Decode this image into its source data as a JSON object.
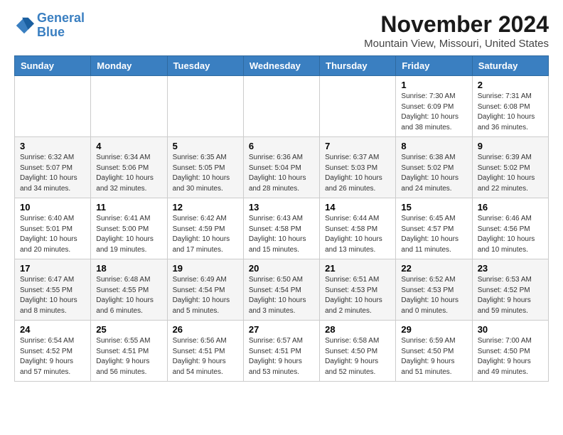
{
  "logo": {
    "line1": "General",
    "line2": "Blue"
  },
  "header": {
    "title": "November 2024",
    "location": "Mountain View, Missouri, United States"
  },
  "days_of_week": [
    "Sunday",
    "Monday",
    "Tuesday",
    "Wednesday",
    "Thursday",
    "Friday",
    "Saturday"
  ],
  "weeks": [
    [
      {
        "day": "",
        "info": ""
      },
      {
        "day": "",
        "info": ""
      },
      {
        "day": "",
        "info": ""
      },
      {
        "day": "",
        "info": ""
      },
      {
        "day": "",
        "info": ""
      },
      {
        "day": "1",
        "info": "Sunrise: 7:30 AM\nSunset: 6:09 PM\nDaylight: 10 hours and 38 minutes."
      },
      {
        "day": "2",
        "info": "Sunrise: 7:31 AM\nSunset: 6:08 PM\nDaylight: 10 hours and 36 minutes."
      }
    ],
    [
      {
        "day": "3",
        "info": "Sunrise: 6:32 AM\nSunset: 5:07 PM\nDaylight: 10 hours and 34 minutes."
      },
      {
        "day": "4",
        "info": "Sunrise: 6:34 AM\nSunset: 5:06 PM\nDaylight: 10 hours and 32 minutes."
      },
      {
        "day": "5",
        "info": "Sunrise: 6:35 AM\nSunset: 5:05 PM\nDaylight: 10 hours and 30 minutes."
      },
      {
        "day": "6",
        "info": "Sunrise: 6:36 AM\nSunset: 5:04 PM\nDaylight: 10 hours and 28 minutes."
      },
      {
        "day": "7",
        "info": "Sunrise: 6:37 AM\nSunset: 5:03 PM\nDaylight: 10 hours and 26 minutes."
      },
      {
        "day": "8",
        "info": "Sunrise: 6:38 AM\nSunset: 5:02 PM\nDaylight: 10 hours and 24 minutes."
      },
      {
        "day": "9",
        "info": "Sunrise: 6:39 AM\nSunset: 5:02 PM\nDaylight: 10 hours and 22 minutes."
      }
    ],
    [
      {
        "day": "10",
        "info": "Sunrise: 6:40 AM\nSunset: 5:01 PM\nDaylight: 10 hours and 20 minutes."
      },
      {
        "day": "11",
        "info": "Sunrise: 6:41 AM\nSunset: 5:00 PM\nDaylight: 10 hours and 19 minutes."
      },
      {
        "day": "12",
        "info": "Sunrise: 6:42 AM\nSunset: 4:59 PM\nDaylight: 10 hours and 17 minutes."
      },
      {
        "day": "13",
        "info": "Sunrise: 6:43 AM\nSunset: 4:58 PM\nDaylight: 10 hours and 15 minutes."
      },
      {
        "day": "14",
        "info": "Sunrise: 6:44 AM\nSunset: 4:58 PM\nDaylight: 10 hours and 13 minutes."
      },
      {
        "day": "15",
        "info": "Sunrise: 6:45 AM\nSunset: 4:57 PM\nDaylight: 10 hours and 11 minutes."
      },
      {
        "day": "16",
        "info": "Sunrise: 6:46 AM\nSunset: 4:56 PM\nDaylight: 10 hours and 10 minutes."
      }
    ],
    [
      {
        "day": "17",
        "info": "Sunrise: 6:47 AM\nSunset: 4:55 PM\nDaylight: 10 hours and 8 minutes."
      },
      {
        "day": "18",
        "info": "Sunrise: 6:48 AM\nSunset: 4:55 PM\nDaylight: 10 hours and 6 minutes."
      },
      {
        "day": "19",
        "info": "Sunrise: 6:49 AM\nSunset: 4:54 PM\nDaylight: 10 hours and 5 minutes."
      },
      {
        "day": "20",
        "info": "Sunrise: 6:50 AM\nSunset: 4:54 PM\nDaylight: 10 hours and 3 minutes."
      },
      {
        "day": "21",
        "info": "Sunrise: 6:51 AM\nSunset: 4:53 PM\nDaylight: 10 hours and 2 minutes."
      },
      {
        "day": "22",
        "info": "Sunrise: 6:52 AM\nSunset: 4:53 PM\nDaylight: 10 hours and 0 minutes."
      },
      {
        "day": "23",
        "info": "Sunrise: 6:53 AM\nSunset: 4:52 PM\nDaylight: 9 hours and 59 minutes."
      }
    ],
    [
      {
        "day": "24",
        "info": "Sunrise: 6:54 AM\nSunset: 4:52 PM\nDaylight: 9 hours and 57 minutes."
      },
      {
        "day": "25",
        "info": "Sunrise: 6:55 AM\nSunset: 4:51 PM\nDaylight: 9 hours and 56 minutes."
      },
      {
        "day": "26",
        "info": "Sunrise: 6:56 AM\nSunset: 4:51 PM\nDaylight: 9 hours and 54 minutes."
      },
      {
        "day": "27",
        "info": "Sunrise: 6:57 AM\nSunset: 4:51 PM\nDaylight: 9 hours and 53 minutes."
      },
      {
        "day": "28",
        "info": "Sunrise: 6:58 AM\nSunset: 4:50 PM\nDaylight: 9 hours and 52 minutes."
      },
      {
        "day": "29",
        "info": "Sunrise: 6:59 AM\nSunset: 4:50 PM\nDaylight: 9 hours and 51 minutes."
      },
      {
        "day": "30",
        "info": "Sunrise: 7:00 AM\nSunset: 4:50 PM\nDaylight: 9 hours and 49 minutes."
      }
    ]
  ]
}
